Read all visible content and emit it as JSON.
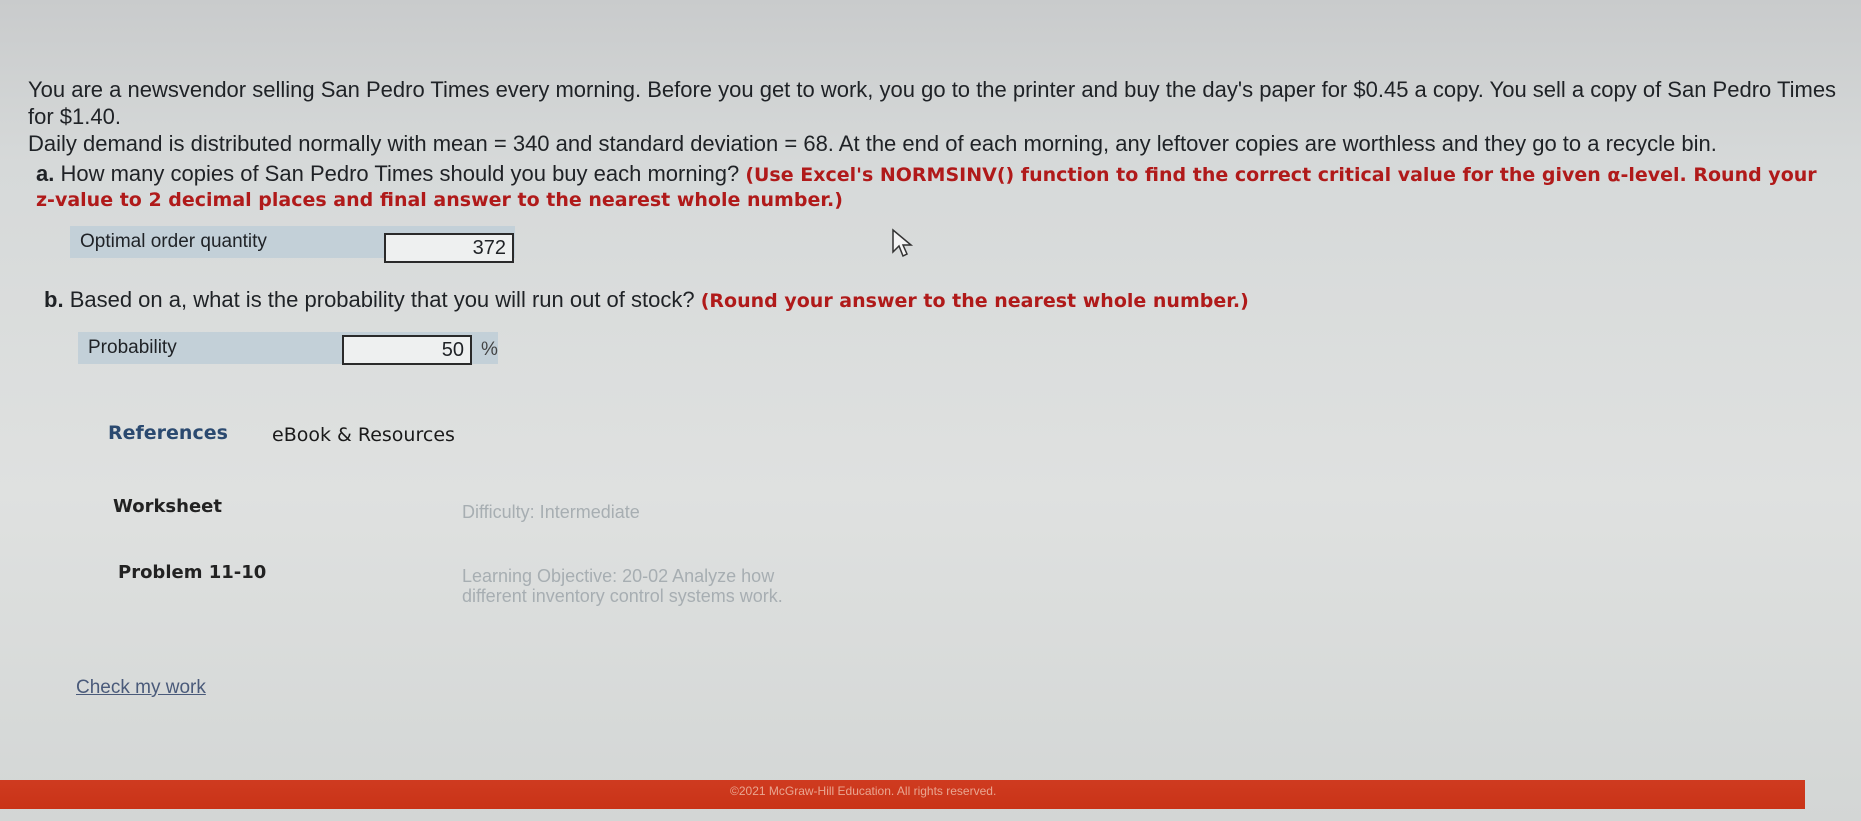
{
  "problem": {
    "intro_line1": "You are a newsvendor selling San Pedro Times every morning. Before you get to work, you go to the printer and buy the day's paper for $0.45 a copy. You sell a copy of San Pedro Times for $1.40.",
    "intro_line2": "Daily demand is distributed normally with mean = 340 and standard deviation = 68. At the end of each morning, any leftover copies are worthless and they go to a recycle bin."
  },
  "part_a": {
    "label": "a.",
    "question": "How many copies of San Pedro Times should you buy each morning?",
    "hint": "(Use Excel's NORMSINV() function to find the correct critical value for the given α-level. Round your z-value to 2 decimal places and final answer to the nearest whole number.)",
    "field_label": "Optimal order quantity",
    "field_value": "372"
  },
  "part_b": {
    "label": "b.",
    "question": "Based on a, what is the probability that you will run out of stock?",
    "hint": "(Round your answer to the nearest whole number.)",
    "field_label": "Probability",
    "field_value": "50",
    "unit": "%"
  },
  "tabs": {
    "references": "References",
    "ebook": "eBook & Resources"
  },
  "info": {
    "worksheet_key": "Worksheet",
    "worksheet_value": "Difficulty: Intermediate",
    "problem_key": "Problem 11-10",
    "problem_value": "Learning Objective: 20-02 Analyze how different inventory control systems work."
  },
  "actions": {
    "check": "Check my work"
  },
  "footer": {
    "copyright": "©2021 McGraw-Hill Education. All rights reserved."
  },
  "icons": {
    "cursor": "mouse-pointer-icon"
  }
}
